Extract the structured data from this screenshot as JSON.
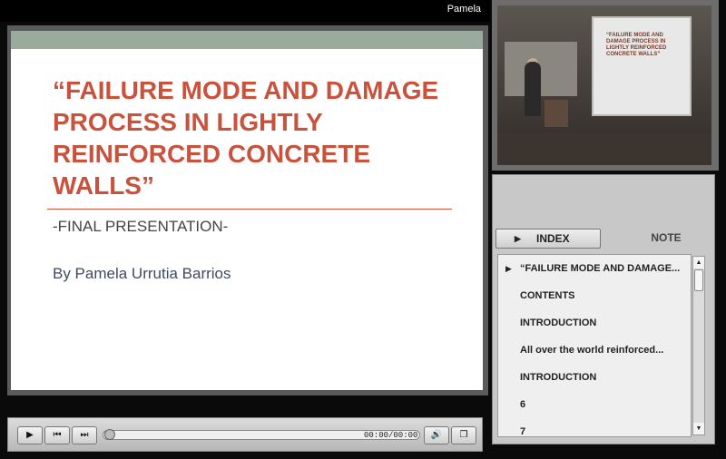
{
  "presenter": {
    "name": "Pamela"
  },
  "slide": {
    "title": "“FAILURE MODE AND DAMAGE PROCESS IN LIGHTLY REINFORCED CONCRETE WALLS”",
    "subtitle": "-FINAL PRESENTATION-",
    "author": "By Pamela Urrutia Barrios"
  },
  "video": {
    "screen_text": "“FAILURE MODE AND DAMAGE PROCESS IN LIGHTLY REINFORCED CONCRETE WALLS”"
  },
  "player": {
    "time": "00:00/00:00",
    "progress_fraction": 0
  },
  "tabs": {
    "index_label": "INDEX",
    "note_label": "NOTE"
  },
  "index": {
    "items": [
      "“FAILURE MODE AND DAMAGE...",
      "CONTENTS",
      "INTRODUCTION",
      "All over the world reinforced...",
      "INTRODUCTION",
      "6",
      "7"
    ]
  },
  "colors": {
    "title_red": "#c9523d",
    "header_green": "#9aaa9c"
  },
  "icons": {
    "play": "play-icon",
    "previous": "skip-back-icon",
    "next": "skip-forward-icon",
    "volume": "speaker-icon",
    "window": "window-restore-icon"
  }
}
